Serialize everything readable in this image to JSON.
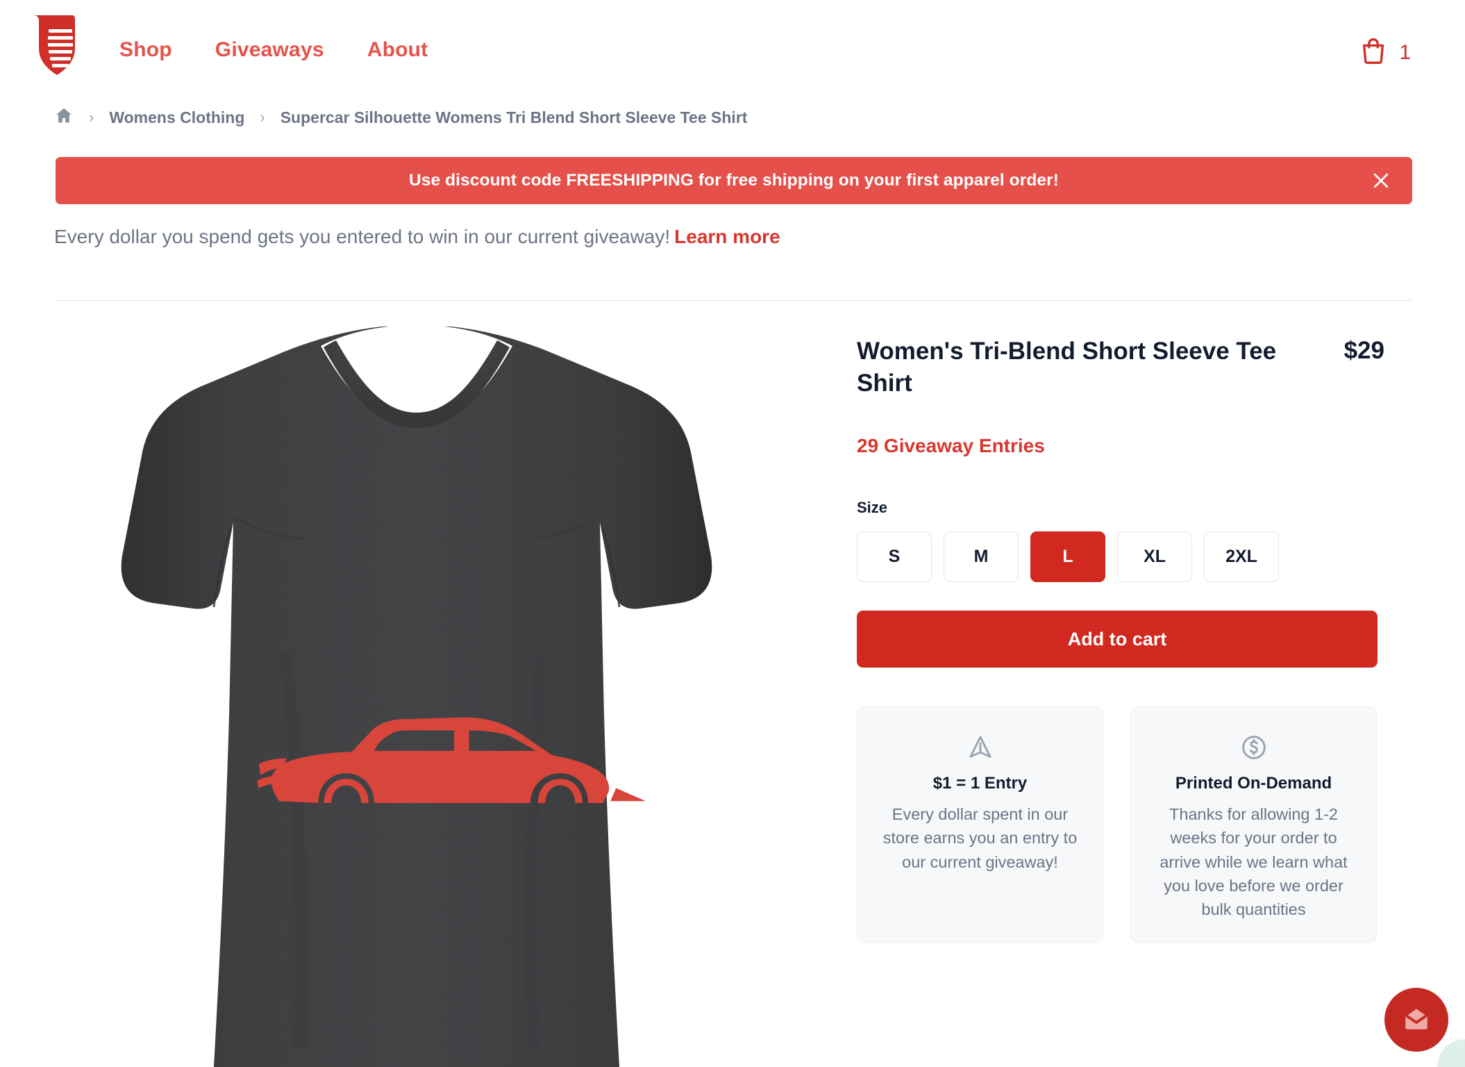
{
  "header": {
    "logo_icon": "flag-shield-logo-icon",
    "nav": [
      {
        "label": "Shop"
      },
      {
        "label": "Giveaways"
      },
      {
        "label": "About"
      }
    ],
    "cart": {
      "icon": "shopping-bag-icon",
      "count": "1"
    }
  },
  "breadcrumb": {
    "home_icon": "home-icon",
    "separator": "›",
    "items": [
      {
        "label": "Womens Clothing"
      },
      {
        "label": "Supercar Silhouette Womens Tri Blend Short Sleeve Tee Shirt"
      }
    ]
  },
  "banner": {
    "message": "Use discount code FREESHIPPING for free shipping on your first apparel order!",
    "close_icon": "close-icon",
    "background_color": "#e5514a"
  },
  "giveaway_notice": {
    "text": "Every dollar you spend gets you entered to win in our current giveaway!",
    "link_label": "Learn more",
    "link_color": "#d8372f"
  },
  "product": {
    "image_alt": "Womens dark grey heather tri-blend tee with red supercar silhouette graphic",
    "shirt_color": "#3a3a3c",
    "graphic_color": "#d8453b",
    "title": "Women's Tri-Blend Short Sleeve Tee Shirt",
    "price": "$29",
    "entries": "29 Giveaway Entries",
    "size_label": "Size",
    "sizes": [
      {
        "label": "S",
        "selected": false
      },
      {
        "label": "M",
        "selected": false
      },
      {
        "label": "L",
        "selected": true
      },
      {
        "label": "XL",
        "selected": false
      },
      {
        "label": "2XL",
        "selected": false
      }
    ],
    "add_to_cart_label": "Add to cart",
    "accent_color": "#d1291f"
  },
  "info_cards": [
    {
      "icon": "navigation-arrow-icon",
      "title": "$1 = 1 Entry",
      "body": "Every dollar spent in our store earns you an entry to our current giveaway!"
    },
    {
      "icon": "dollar-circle-icon",
      "title": "Printed On-Demand",
      "body": "Thanks for allowing 1-2 weeks for your order to arrive while we learn what you love before we order bulk quantities"
    }
  ],
  "chat_widget": {
    "icon": "envelope-icon",
    "background_color": "#c42a22"
  }
}
